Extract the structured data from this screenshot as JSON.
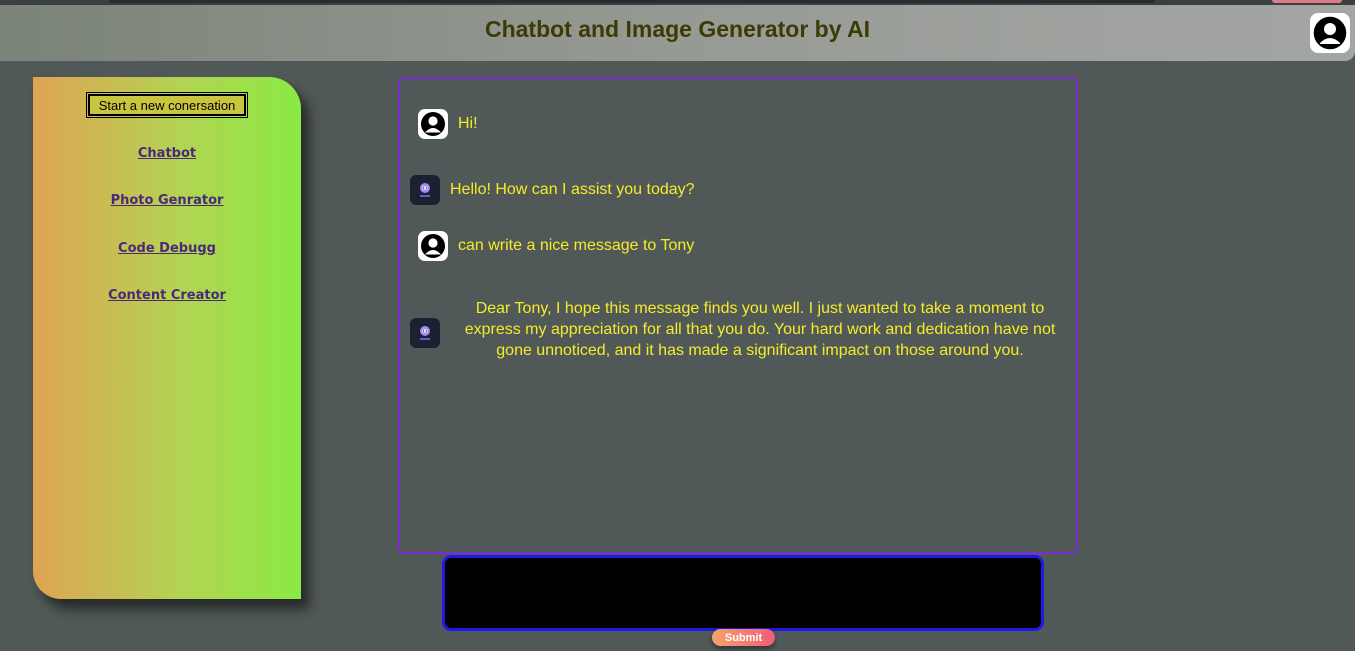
{
  "header": {
    "title": "Chatbot and Image Generator by AI",
    "avatar_icon": "user-avatar-icon"
  },
  "sidebar": {
    "new_conversation_label": "Start a new conersation",
    "links": [
      {
        "label": "Chatbot"
      },
      {
        "label": "Photo Genrator"
      },
      {
        "label": "Code Debugg"
      },
      {
        "label": "Content Creator"
      }
    ]
  },
  "chat": {
    "messages": [
      {
        "role": "user",
        "icon": "user-avatar-icon",
        "text": "Hi!"
      },
      {
        "role": "bot",
        "icon": "bot-icon",
        "text": "Hello! How can I assist you today?"
      },
      {
        "role": "user",
        "icon": "user-avatar-icon",
        "text": "can write a nice message to Tony"
      },
      {
        "role": "bot",
        "icon": "bot-icon",
        "text": "Dear Tony, I hope this message finds you well. I just wanted to take a moment to express my appreciation for all that you do. Your hard work and dedication have not gone unnoticed, and it has made a significant impact on those around you."
      }
    ]
  },
  "input": {
    "value": "",
    "placeholder": ""
  },
  "submit_label": "Submit",
  "colors": {
    "message_text": "#f4ec2a",
    "chat_border": "#7b2fd0",
    "input_border": "#1d1ae8",
    "header_title": "#3d3b05"
  }
}
